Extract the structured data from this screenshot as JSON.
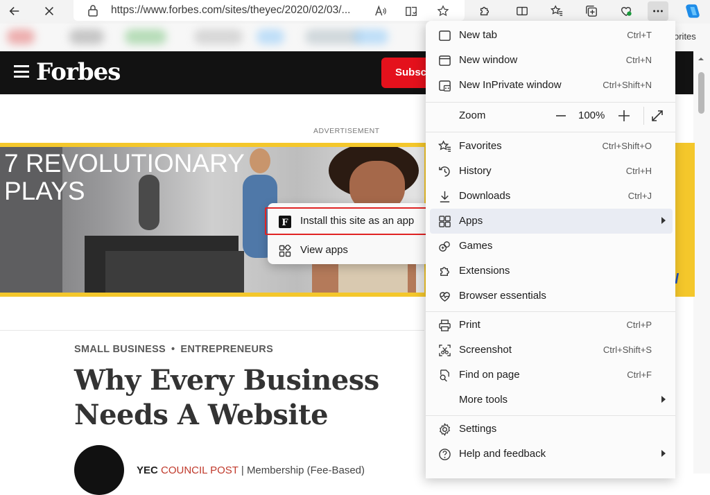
{
  "browser": {
    "url": "https://www.forbes.com/sites/theyec/2020/02/03/...",
    "favorites_tail": "orites"
  },
  "page": {
    "logo": "Forbes",
    "subscribe": "Subsc",
    "ad_label": "ADVERTISEMENT",
    "ad_headline_1": "7 REVOLUTIONARY",
    "ad_headline_2": "PLAYS",
    "ad_right_text": "al",
    "kicker_1": "SMALL BUSINESS",
    "kicker_sep": "•",
    "kicker_2": "ENTREPRENEURS",
    "title": "Why Every Business Needs A Website",
    "author_name": "YEC",
    "author_post": "COUNCIL POST",
    "author_rest": "| Membership (Fee-Based)"
  },
  "apps_submenu": {
    "items": [
      {
        "label": "Install this site as an app",
        "icon": "forbes-f-icon"
      },
      {
        "label": "View apps",
        "icon": "apps-grid-icon"
      }
    ]
  },
  "menu": {
    "new_tab": {
      "label": "New tab",
      "shortcut": "Ctrl+T"
    },
    "new_window": {
      "label": "New window",
      "shortcut": "Ctrl+N"
    },
    "new_inprivate": {
      "label": "New InPrivate window",
      "shortcut": "Ctrl+Shift+N"
    },
    "zoom": {
      "label": "Zoom",
      "value": "100%"
    },
    "favorites": {
      "label": "Favorites",
      "shortcut": "Ctrl+Shift+O"
    },
    "history": {
      "label": "History",
      "shortcut": "Ctrl+H"
    },
    "downloads": {
      "label": "Downloads",
      "shortcut": "Ctrl+J"
    },
    "apps": {
      "label": "Apps"
    },
    "games": {
      "label": "Games"
    },
    "extensions": {
      "label": "Extensions"
    },
    "browser_essentials": {
      "label": "Browser essentials"
    },
    "print": {
      "label": "Print",
      "shortcut": "Ctrl+P"
    },
    "screenshot": {
      "label": "Screenshot",
      "shortcut": "Ctrl+Shift+S"
    },
    "find_on_page": {
      "label": "Find on page",
      "shortcut": "Ctrl+F"
    },
    "more_tools": {
      "label": "More tools"
    },
    "settings": {
      "label": "Settings"
    },
    "help": {
      "label": "Help and feedback"
    }
  },
  "colors": {
    "forbes_header": "#121212",
    "subscribe_red": "#e4111c",
    "ad_yellow": "#f4c72b",
    "highlight_red": "#e02323",
    "apps_highlight": "#e9ecf3"
  }
}
